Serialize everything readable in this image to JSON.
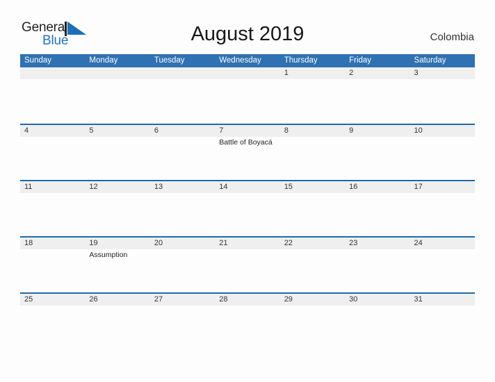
{
  "brand": {
    "name_part1": "General",
    "name_part2": "Blue",
    "flag_icon": "flag-triangle-icon",
    "color_dark": "#231f20",
    "color_blue": "#2472b8"
  },
  "header": {
    "title": "August 2019",
    "country": "Colombia"
  },
  "theme": {
    "header_blue": "#2f71b2",
    "divider_blue": "#1f6aa5",
    "band_gray": "#efefef",
    "page_bg": "#fdfdfd"
  },
  "calendar": {
    "month": "August",
    "year": "2019",
    "weekdays": [
      "Sunday",
      "Monday",
      "Tuesday",
      "Wednesday",
      "Thursday",
      "Friday",
      "Saturday"
    ],
    "weeks": [
      {
        "days": [
          {
            "num": "",
            "event": ""
          },
          {
            "num": "",
            "event": ""
          },
          {
            "num": "",
            "event": ""
          },
          {
            "num": "",
            "event": ""
          },
          {
            "num": "1",
            "event": ""
          },
          {
            "num": "2",
            "event": ""
          },
          {
            "num": "3",
            "event": ""
          }
        ]
      },
      {
        "days": [
          {
            "num": "4",
            "event": ""
          },
          {
            "num": "5",
            "event": ""
          },
          {
            "num": "6",
            "event": ""
          },
          {
            "num": "7",
            "event": "Battle of Boyacá"
          },
          {
            "num": "8",
            "event": ""
          },
          {
            "num": "9",
            "event": ""
          },
          {
            "num": "10",
            "event": ""
          }
        ]
      },
      {
        "days": [
          {
            "num": "11",
            "event": ""
          },
          {
            "num": "12",
            "event": ""
          },
          {
            "num": "13",
            "event": ""
          },
          {
            "num": "14",
            "event": ""
          },
          {
            "num": "15",
            "event": ""
          },
          {
            "num": "16",
            "event": ""
          },
          {
            "num": "17",
            "event": ""
          }
        ]
      },
      {
        "days": [
          {
            "num": "18",
            "event": ""
          },
          {
            "num": "19",
            "event": "Assumption"
          },
          {
            "num": "20",
            "event": ""
          },
          {
            "num": "21",
            "event": ""
          },
          {
            "num": "22",
            "event": ""
          },
          {
            "num": "23",
            "event": ""
          },
          {
            "num": "24",
            "event": ""
          }
        ]
      },
      {
        "days": [
          {
            "num": "25",
            "event": ""
          },
          {
            "num": "26",
            "event": ""
          },
          {
            "num": "27",
            "event": ""
          },
          {
            "num": "28",
            "event": ""
          },
          {
            "num": "29",
            "event": ""
          },
          {
            "num": "30",
            "event": ""
          },
          {
            "num": "31",
            "event": ""
          }
        ]
      }
    ]
  }
}
